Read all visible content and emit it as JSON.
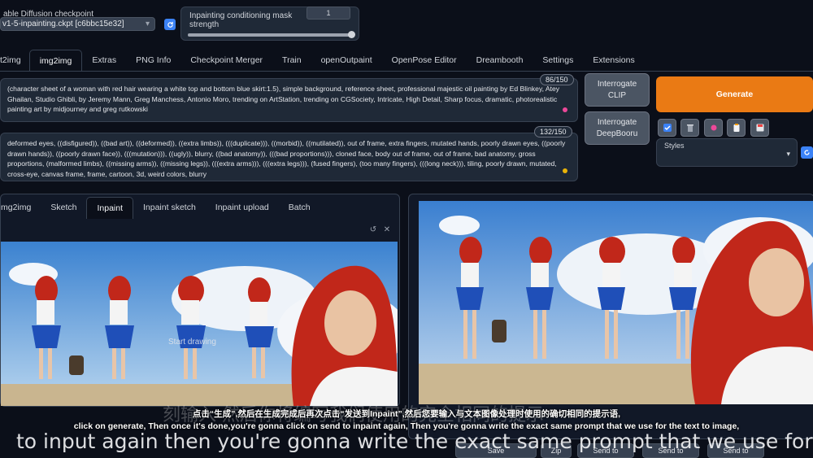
{
  "checkpoint": {
    "label": "able Diffusion checkpoint",
    "value": "v1-5-inpainting.ckpt [c6bbc15e32]"
  },
  "mask_strength": {
    "label_line1": "Inpainting conditioning mask",
    "label_line2": "strength",
    "value": "1",
    "fraction": 1.0
  },
  "top_tabs": [
    "t2img",
    "img2img",
    "Extras",
    "PNG Info",
    "Checkpoint Merger",
    "Train",
    "openOutpaint",
    "OpenPose Editor",
    "Dreambooth",
    "Settings",
    "Extensions"
  ],
  "active_top_tab": "img2img",
  "positive_prompt": {
    "text": "(character sheet of a woman with red hair wearing a white top and bottom blue skirt:1.5), simple background, reference sheet, professional majestic oil painting by Ed Blinkey, Atey Ghailan, Studio Ghibli, by Jeremy Mann, Greg Manchess, Antonio Moro, trending on ArtStation, trending on CGSociety, Intricate, High Detail, Sharp focus, dramatic, photorealistic painting art by midjourney and greg rutkowski",
    "counter": "86/150"
  },
  "negative_prompt": {
    "text": "deformed eyes, ((disfigured)), ((bad art)), ((deformed)), ((extra limbs)), (((duplicate))), ((morbid)), ((mutilated)), out of frame, extra fingers, mutated hands, poorly drawn eyes, ((poorly drawn hands)), ((poorly drawn face)), (((mutation))), ((ugly)), blurry, ((bad anatomy)), (((bad proportions))), cloned face, body out of frame, out of frame, bad anatomy, gross proportions, (malformed limbs), ((missing arms)), ((missing legs)), (((extra arms))), (((extra legs))), (fused fingers), (too many fingers), (((long neck))), tiling, poorly drawn, mutated, cross-eye, canvas frame, frame, cartoon, 3d, weird colors, blurry",
    "counter": "132/150"
  },
  "buttons": {
    "interrogate_clip_line1": "Interrogate",
    "interrogate_clip_line2": "CLIP",
    "interrogate_deepbooru_line1": "Interrogate",
    "interrogate_deepbooru_line2": "DeepBooru",
    "generate": "Generate"
  },
  "styles": {
    "label": "Styles"
  },
  "sub_tabs": [
    "mg2img",
    "Sketch",
    "Inpaint",
    "Inpaint sketch",
    "Inpaint upload",
    "Batch"
  ],
  "active_sub_tab": "Inpaint",
  "canvas_hint": "Start drawing",
  "output_buttons": [
    "Save",
    "Zip",
    "Send to",
    "Send to",
    "Send to"
  ],
  "subtitles": {
    "chinese": "点击“生成”,然后在生成完成后再次点击“发送到Inpaint”,然后您要输入与文本图像处理时使用的确切相同的提示语,",
    "english": "click on generate, Then once it's done,you're gonna click on send to inpaint again, Then you're gonna write the exact same prompt that we use for the text to image,",
    "overlay_caption": "to input again then you're gonna write the exact same prompt that we use for",
    "overlay_chinese_partial": "刻输入 然后你将编写我们使用的完全相同的提示"
  },
  "colors": {
    "background": "#0b0f19",
    "panel": "#1f2937",
    "generate": "#ea7a14",
    "sky": "#4f8fd6",
    "hair": "#c1271a",
    "skirt": "#1f4fb8"
  },
  "icons": [
    "refresh-icon",
    "close-icon",
    "edit-icon",
    "checkbox-icon",
    "trash-icon",
    "dot-icon",
    "clipboard-icon",
    "save-icon",
    "chevron-down-icon"
  ]
}
